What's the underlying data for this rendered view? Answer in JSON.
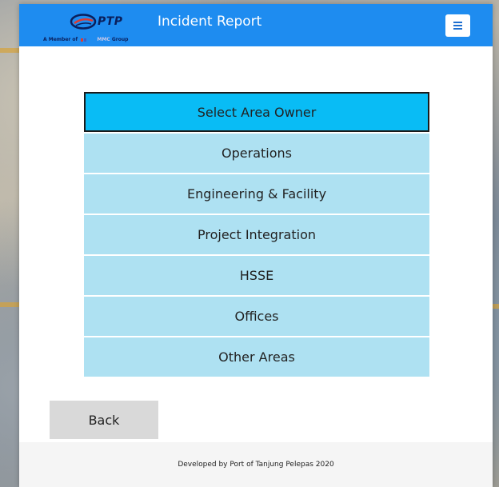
{
  "header": {
    "logo_text": "PTP",
    "logo_tagline_prefix": "A Member of",
    "logo_tagline_group": "MMC",
    "logo_tagline_suffix": "Group",
    "title": "Incident Report",
    "menu_icon": "hamburger-menu-icon"
  },
  "area_selector": {
    "heading": "Select Area Owner",
    "options": [
      {
        "label": "Operations"
      },
      {
        "label": "Engineering & Facility"
      },
      {
        "label": "Project Integration"
      },
      {
        "label": "HSSE"
      },
      {
        "label": "Offices"
      },
      {
        "label": "Other Areas"
      }
    ]
  },
  "back_button": {
    "label": "Back"
  },
  "footer": {
    "text": "Developed by Port of Tanjung Pelepas 2020"
  },
  "colors": {
    "header_bg": "#1e8cf0",
    "heading_bg": "#09bcf5",
    "option_bg": "#aee1f2",
    "back_bg": "#d9d9d9",
    "footer_bg": "#f5f5f5"
  }
}
